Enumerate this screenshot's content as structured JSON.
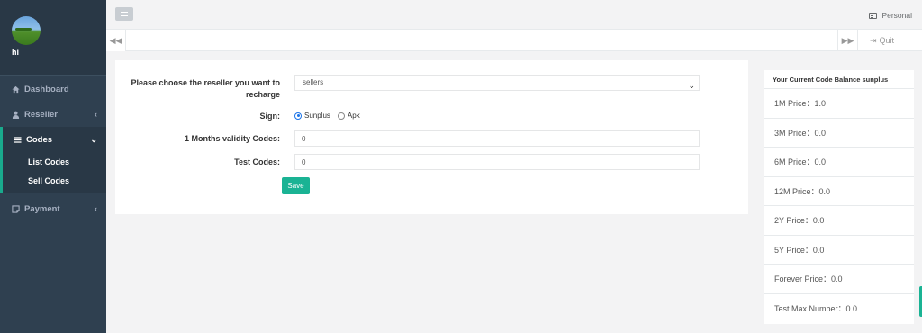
{
  "sidebar": {
    "profile_name": "hi",
    "items": [
      {
        "label": "Dashboard",
        "icon": "home-icon"
      },
      {
        "label": "Reseller",
        "icon": "user-icon"
      },
      {
        "label": "Codes",
        "icon": "bars-icon",
        "children": [
          "List Codes",
          "Sell Codes"
        ]
      },
      {
        "label": "Payment",
        "icon": "note-icon"
      }
    ]
  },
  "topbar": {
    "personal_label": "Personal"
  },
  "tabbar": {
    "quit_label": "Quit"
  },
  "form": {
    "reseller_label": "Please choose the reseller you want to recharge",
    "reseller_value": "sellers",
    "sign_label": "Sign:",
    "sign_options": [
      "Sunplus",
      "Apk"
    ],
    "sign_selected": "Sunplus",
    "months_label": "1 Months validity Codes:",
    "months_value": "0",
    "test_label": "Test Codes:",
    "test_value": "0",
    "save_label": "Save"
  },
  "balance": {
    "title": "Your Current Code Balance sunplus",
    "prices": [
      "1M Price：1.0",
      "3M Price：0.0",
      "6M Price：0.0",
      "12M Price：0.0",
      "2Y Price：0.0",
      "5Y Price：0.0",
      "Forever Price：0.0",
      "Test Max Number：0.0"
    ]
  },
  "colors": {
    "sidebar_bg": "#2f4050",
    "accent": "#1ab394"
  }
}
